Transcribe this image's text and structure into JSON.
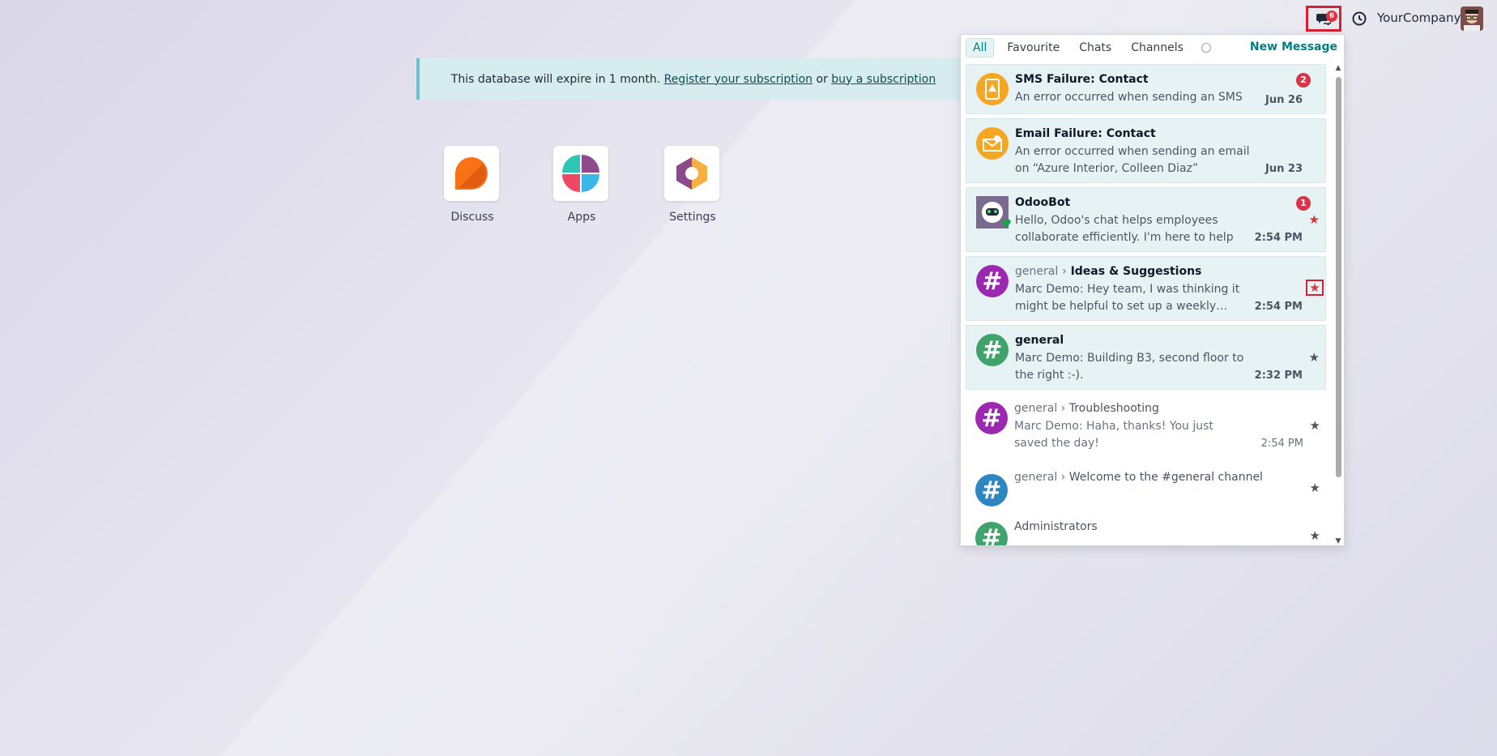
{
  "topbar": {
    "chat_count": "6",
    "company": "YourCompany"
  },
  "banner": {
    "text": "This database will expire in 1 month.",
    "link1": "Register your subscription",
    "sep": "or",
    "link2": "buy a subscription"
  },
  "apps": [
    {
      "label": "Discuss"
    },
    {
      "label": "Apps"
    },
    {
      "label": "Settings"
    }
  ],
  "messaging": {
    "tabs": [
      "All",
      "Favourite",
      "Chats",
      "Channels"
    ],
    "new_message": "New Message",
    "items": [
      {
        "title": "SMS Failure: Contact",
        "body": "An error occurred when sending an SMS",
        "date": "Jun 26",
        "count": "2"
      },
      {
        "title": "Email Failure: Contact",
        "body": "An error occurred when sending an email on “Azure Interior, Colleen Diaz”",
        "date": "Jun 23"
      },
      {
        "title": "OdooBot",
        "body": "Hello, Odoo's chat helps employees collaborate efficiently. I'm here to help yo…",
        "date": "2:54 PM",
        "count": "1"
      },
      {
        "parent": "general",
        "title": "Ideas & Suggestions",
        "body": "Marc Demo: Hey team, I was thinking it might be helpful to set up a weekly…",
        "date": "2:54 PM"
      },
      {
        "title": "general",
        "body": "Marc Demo: Building B3, second floor to the right :-).",
        "date": "2:32 PM"
      },
      {
        "parent": "general",
        "title": "Troubleshooting",
        "body": "Marc Demo: Haha, thanks! You just saved the day!",
        "date": "2:54 PM"
      },
      {
        "parent": "general",
        "title": "Welcome to the #general channel",
        "body": ""
      },
      {
        "title": "Administrators",
        "body": ""
      }
    ]
  },
  "colors": {
    "accent": "#017e84",
    "badge": "#d9344a"
  }
}
